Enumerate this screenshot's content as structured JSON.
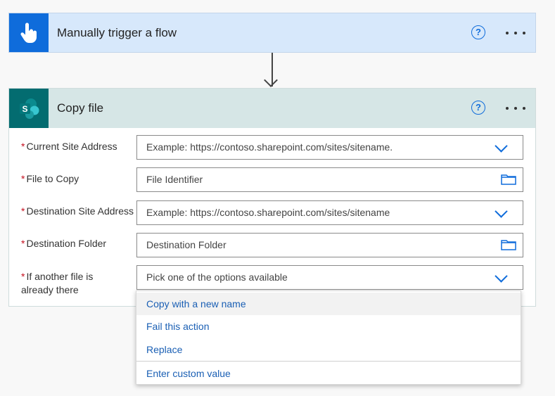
{
  "trigger": {
    "title": "Manually trigger a flow",
    "icon": "touch-hand-icon",
    "help": "?"
  },
  "action": {
    "title": "Copy file",
    "icon": "sharepoint-icon",
    "icon_letter": "S",
    "help": "?"
  },
  "fields": [
    {
      "label": "Current Site Address",
      "required": "*",
      "value": "Example: https://contoso.sharepoint.com/sites/sitename.",
      "control": "dropdown"
    },
    {
      "label": "File to Copy",
      "required": "*",
      "value": "File Identifier",
      "control": "folder-picker"
    },
    {
      "label": "Destination Site Address",
      "required": "*",
      "value": "Example: https://contoso.sharepoint.com/sites/sitename",
      "control": "dropdown"
    },
    {
      "label": "Destination Folder",
      "required": "*",
      "value": "Destination Folder",
      "control": "folder-picker"
    },
    {
      "label": "If another file is already there",
      "required": "*",
      "value": "Pick one of the options available",
      "control": "dropdown"
    }
  ],
  "dropdown": {
    "options": [
      "Copy with a new name",
      "Fail this action",
      "Replace"
    ],
    "custom": "Enter custom value"
  },
  "colors": {
    "trigger_header": "#d7e8fb",
    "trigger_icon_bg": "#0f6cdb",
    "action_header": "#d6e6e6",
    "sharepoint_bg": "#036c70",
    "required": "#c50f1f",
    "link": "#1a5fb4"
  }
}
